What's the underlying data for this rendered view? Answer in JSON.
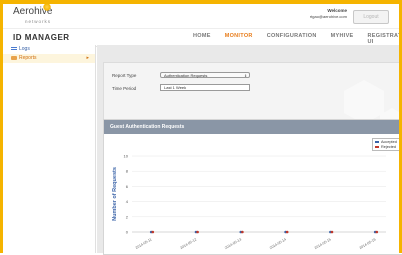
{
  "header": {
    "logo_text": "Aerohive",
    "logo_sub": "networks",
    "welcome_label": "Welcome",
    "welcome_email": "rtgao@aerohive.com",
    "logout_label": "Logout"
  },
  "nav": {
    "page_title": "ID MANAGER",
    "tabs": [
      {
        "label": "HOME",
        "active": false
      },
      {
        "label": "MONITOR",
        "active": true
      },
      {
        "label": "CONFIGURATION",
        "active": false
      },
      {
        "label": "MYHIVE",
        "active": false
      },
      {
        "label": "REGISTRATION UI",
        "active": false
      }
    ]
  },
  "sidebar": {
    "items": [
      {
        "label": "Logs",
        "icon": "list-icon",
        "active": false
      },
      {
        "label": "Reports",
        "icon": "folder-icon",
        "active": true
      }
    ]
  },
  "form": {
    "report_type_label": "Report Type",
    "report_type_value": "Authentication Requests",
    "time_period_label": "Time Period",
    "time_period_value": "Last 1 Week"
  },
  "colors": {
    "accent": "#f5b400",
    "active_tab": "#e87c1a",
    "accepted": "#3a63a8",
    "rejected": "#c0392b"
  },
  "chart_data": {
    "type": "line",
    "title": "Guest Authentication Requests",
    "xlabel": "",
    "ylabel": "Number of Requests",
    "ylim": [
      0,
      10
    ],
    "yticks": [
      0,
      2,
      4,
      6,
      8,
      10
    ],
    "categories": [
      "2014-05-11",
      "2014-05-12",
      "2014-05-13",
      "2014-05-14",
      "2014-05-15",
      "2014-05-16"
    ],
    "series": [
      {
        "name": "Accepted",
        "values": [
          0,
          0,
          0,
          0,
          0,
          0
        ]
      },
      {
        "name": "Rejected",
        "values": [
          0,
          0,
          0,
          0,
          0,
          0
        ]
      }
    ],
    "legend_position": "top-right",
    "grid": true
  }
}
